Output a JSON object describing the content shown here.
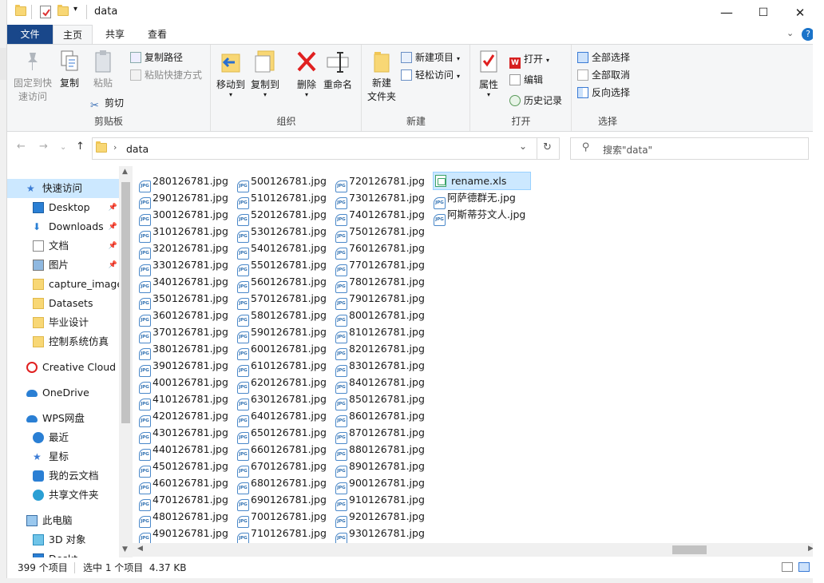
{
  "window": {
    "title": "data",
    "controls": {
      "minimize": "—",
      "maximize": "☐",
      "close": "✕"
    }
  },
  "ribbon_tabs": {
    "file": "文件",
    "home": "主页",
    "share": "共享",
    "view": "查看"
  },
  "ribbon": {
    "clipboard": {
      "pin": "固定到快\n速访问",
      "copy": "复制",
      "paste": "粘贴",
      "copy_path": "复制路径",
      "paste_shortcut": "粘贴快捷方式",
      "cut": "剪切",
      "label": "剪贴板"
    },
    "organize": {
      "move_to": "移动到",
      "copy_to": "复制到",
      "delete": "删除",
      "rename": "重命名",
      "label": "组织"
    },
    "new": {
      "new_folder": "新建\n文件夹",
      "new_item": "新建项目",
      "easy_access": "轻松访问",
      "label": "新建"
    },
    "open": {
      "properties": "属性",
      "open": "打开",
      "edit": "编辑",
      "history": "历史记录",
      "label": "打开"
    },
    "select": {
      "select_all": "全部选择",
      "select_none": "全部取消",
      "invert": "反向选择",
      "label": "选择"
    }
  },
  "address": {
    "path": "data",
    "search_placeholder": "搜索\"data\""
  },
  "nav": [
    {
      "label": "快速访问",
      "icon": "star-icon",
      "pinned": false
    },
    {
      "label": "Desktop",
      "icon": "desktop-icon",
      "pinned": true
    },
    {
      "label": "Downloads",
      "icon": "download-icon",
      "pinned": true
    },
    {
      "label": "文档",
      "icon": "document-icon",
      "pinned": true
    },
    {
      "label": "图片",
      "icon": "picture-icon",
      "pinned": true
    },
    {
      "label": "capture_image",
      "icon": "folder-icon",
      "pinned": false
    },
    {
      "label": "Datasets",
      "icon": "folder-icon",
      "pinned": false
    },
    {
      "label": "毕业设计",
      "icon": "folder-icon",
      "pinned": false
    },
    {
      "label": "控制系统仿真",
      "icon": "folder-icon",
      "pinned": false
    },
    {
      "label": "Creative Cloud F",
      "icon": "creative-cloud-icon",
      "pinned": false
    },
    {
      "label": "OneDrive",
      "icon": "cloud-icon",
      "pinned": false
    },
    {
      "label": "WPS网盘",
      "icon": "cloud-icon",
      "pinned": false
    },
    {
      "label": "最近",
      "icon": "clock-icon",
      "pinned": false
    },
    {
      "label": "星标",
      "icon": "star-icon",
      "pinned": false
    },
    {
      "label": "我的云文档",
      "icon": "cloud-doc-icon",
      "pinned": false
    },
    {
      "label": "共享文件夹",
      "icon": "share-icon",
      "pinned": false
    },
    {
      "label": "此电脑",
      "icon": "computer-icon",
      "pinned": false
    },
    {
      "label": "3D 对象",
      "icon": "cube-icon",
      "pinned": false
    },
    {
      "label": "Deskt",
      "icon": "desktop-icon",
      "pinned": false
    }
  ],
  "files": {
    "col1": [
      "280126781.jpg",
      "290126781.jpg",
      "300126781.jpg",
      "310126781.jpg",
      "320126781.jpg",
      "330126781.jpg",
      "340126781.jpg",
      "350126781.jpg",
      "360126781.jpg",
      "370126781.jpg",
      "380126781.jpg",
      "390126781.jpg",
      "400126781.jpg",
      "410126781.jpg",
      "420126781.jpg",
      "430126781.jpg",
      "440126781.jpg",
      "450126781.jpg",
      "460126781.jpg",
      "470126781.jpg",
      "480126781.jpg",
      "490126781.jpg"
    ],
    "col2": [
      "500126781.jpg",
      "510126781.jpg",
      "520126781.jpg",
      "530126781.jpg",
      "540126781.jpg",
      "550126781.jpg",
      "560126781.jpg",
      "570126781.jpg",
      "580126781.jpg",
      "590126781.jpg",
      "600126781.jpg",
      "610126781.jpg",
      "620126781.jpg",
      "630126781.jpg",
      "640126781.jpg",
      "650126781.jpg",
      "660126781.jpg",
      "670126781.jpg",
      "680126781.jpg",
      "690126781.jpg",
      "700126781.jpg",
      "710126781.jpg"
    ],
    "col3": [
      "720126781.jpg",
      "730126781.jpg",
      "740126781.jpg",
      "750126781.jpg",
      "760126781.jpg",
      "770126781.jpg",
      "780126781.jpg",
      "790126781.jpg",
      "800126781.jpg",
      "810126781.jpg",
      "820126781.jpg",
      "830126781.jpg",
      "840126781.jpg",
      "850126781.jpg",
      "860126781.jpg",
      "870126781.jpg",
      "880126781.jpg",
      "890126781.jpg",
      "900126781.jpg",
      "910126781.jpg",
      "920126781.jpg",
      "930126781.jpg"
    ],
    "col4": [
      {
        "name": "rename.xls",
        "type": "xls",
        "selected": true
      },
      {
        "name": "阿萨德群无.jpg",
        "type": "jpg",
        "selected": false
      },
      {
        "name": "阿斯蒂芬文人.jpg",
        "type": "jpg",
        "selected": false
      }
    ],
    "jpg_badge": "JPG"
  },
  "status": {
    "count": "399 个项目",
    "selection": "选中 1 个项目  4.37 KB"
  },
  "colors": {
    "file_tab": "#19478a",
    "selection": "#cce8ff",
    "accent": "#0078d7"
  }
}
